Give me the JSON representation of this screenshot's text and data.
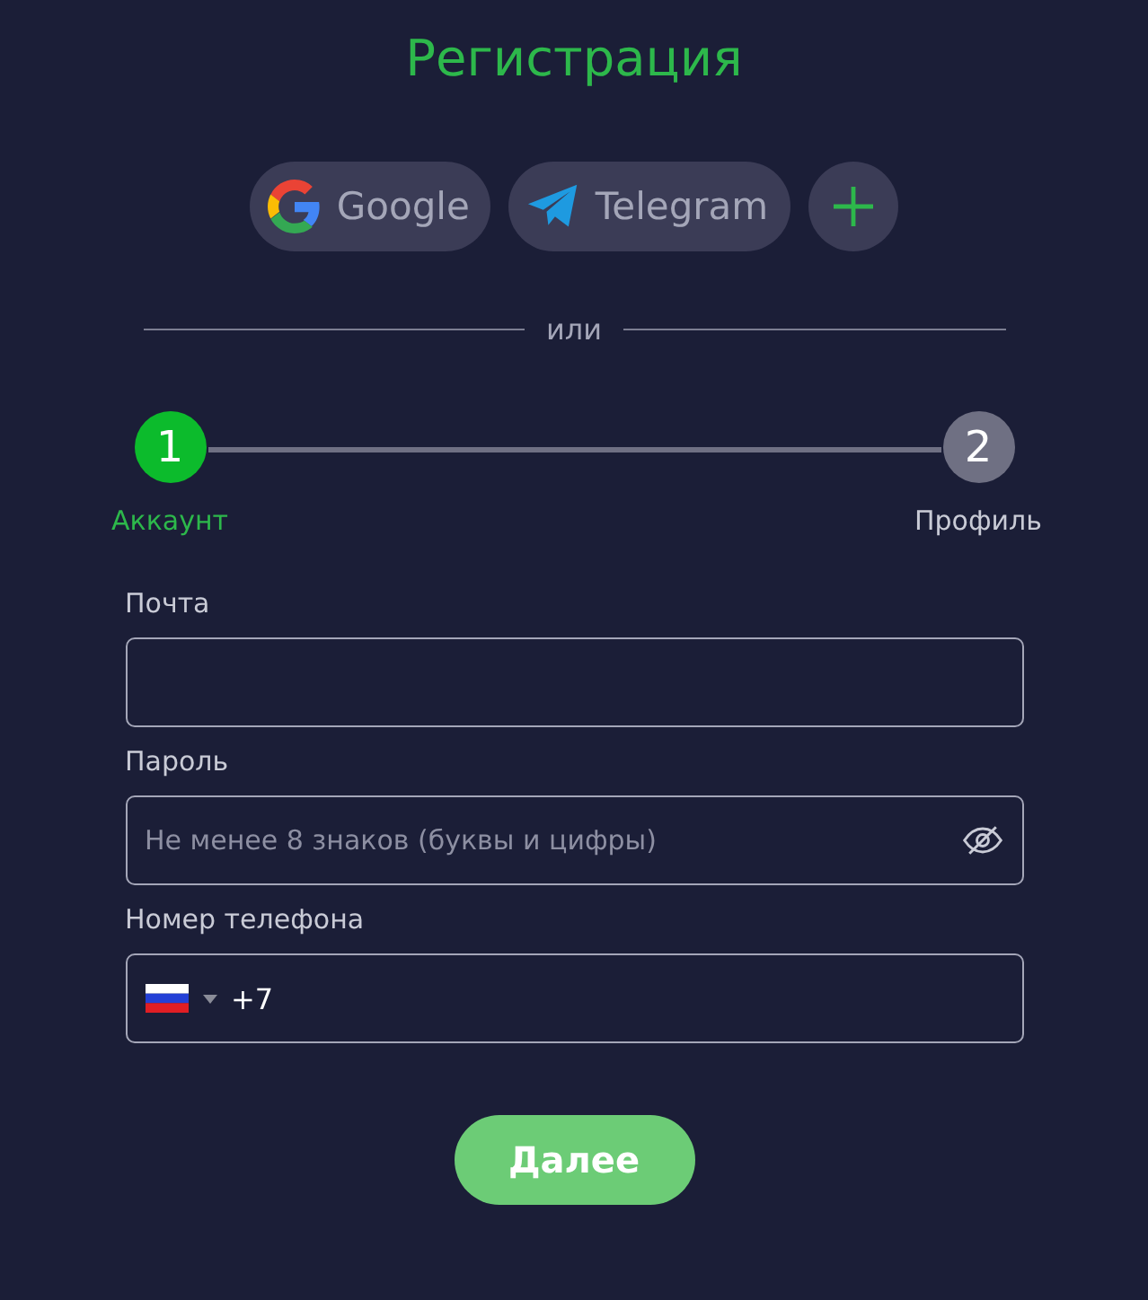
{
  "title": "Регистрация",
  "social_buttons": [
    {
      "kind": "google",
      "label": "Google"
    },
    {
      "kind": "telegram",
      "label": "Telegram"
    },
    {
      "kind": "more"
    }
  ],
  "divider_text": "или",
  "steps": [
    {
      "number": "1",
      "label": "Аккаунт",
      "selected": true
    },
    {
      "number": "2",
      "label": "Профиль",
      "selected": false
    }
  ],
  "fields": [
    {
      "kind": "email",
      "label": "Почта"
    },
    {
      "kind": "password",
      "label": "Пароль",
      "placeholder": "Не менее 8 знаков (буквы и цифры)"
    },
    {
      "kind": "phone",
      "label": "Номер телефона",
      "value": "+7"
    }
  ],
  "submit": "Далее"
}
